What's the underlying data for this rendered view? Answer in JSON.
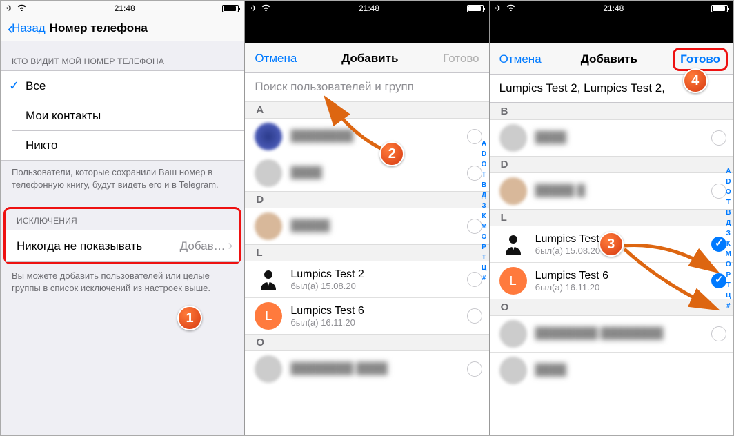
{
  "status": {
    "time": "21:48",
    "airplane": "✈",
    "wifi": "⚲"
  },
  "screen1": {
    "back": "Назад",
    "title": "Номер телефона",
    "section_visibility": "КТО ВИДИТ МОЙ НОМЕР ТЕЛЕФОНА",
    "opt_all": "Все",
    "opt_contacts": "Мои контакты",
    "opt_nobody": "Никто",
    "note_visibility": "Пользователи, которые сохранили Ваш номер в телефонную книгу, будут видеть его и в Telegram.",
    "section_exclusions": "ИСКЛЮЧЕНИЯ",
    "never_show": "Никогда не показывать",
    "add": "Добав…",
    "note_exclusions": "Вы можете добавить пользователей или целые группы в список исключений из настроек выше."
  },
  "screen2": {
    "cancel": "Отмена",
    "title": "Добавить",
    "done": "Готово",
    "search_placeholder": "Поиск пользователей и групп",
    "letters": [
      "A",
      "D",
      "L",
      "O"
    ],
    "lumpics2_name": "Lumpics Test 2",
    "lumpics2_sub": "был(а) 15.08.20",
    "lumpics6_name": "Lumpics Test 6",
    "lumpics6_sub": "был(а) 16.11.20",
    "index": [
      "A",
      "D",
      "O",
      "T",
      "В",
      "Д",
      "З",
      "К",
      "М",
      "О",
      "Р",
      "Т",
      "Ц",
      "#"
    ]
  },
  "screen3": {
    "cancel": "Отмена",
    "title": "Добавить",
    "done": "Готово",
    "selected": "Lumpics Test 2,  Lumpics Test 2,",
    "letters": [
      "B",
      "D",
      "L",
      "O"
    ],
    "lumpics2_name": "Lumpics Test 2",
    "lumpics2_sub": "был(а) 15.08.20",
    "lumpics6_name": "Lumpics Test 6",
    "lumpics6_sub": "был(а) 16.11.20",
    "index": [
      "A",
      "D",
      "O",
      "T",
      "В",
      "Д",
      "З",
      "К",
      "М",
      "О",
      "Р",
      "Т",
      "Ц",
      "#"
    ]
  },
  "steps": {
    "s1": "1",
    "s2": "2",
    "s3": "3",
    "s4": "4"
  }
}
